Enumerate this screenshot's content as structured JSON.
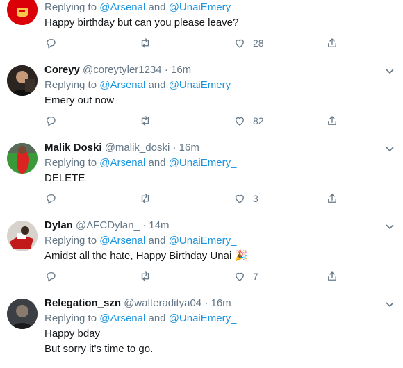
{
  "tweets": [
    {
      "name": "",
      "handle": "",
      "time": "",
      "replying_prefix": "Replying to",
      "mention1": "@Arsenal",
      "and": "and",
      "mention2": "@UnaiEmery_",
      "lines": [
        "Happy birthday but can you please leave?"
      ],
      "likes": "28",
      "avatar": {
        "icon": "arsenal-crest-avatar",
        "bg": "#db0007"
      }
    },
    {
      "name": "Coreyy",
      "handle": "@coreytyler1234",
      "time": "16m",
      "replying_prefix": "Replying to",
      "mention1": "@Arsenal",
      "and": "and",
      "mention2": "@UnaiEmery_",
      "lines": [
        "Emery out now"
      ],
      "likes": "82",
      "avatar": {
        "icon": "user-photo-avatar",
        "bg": "#2b2420"
      }
    },
    {
      "name": "Malik Doski",
      "handle": "@malik_doski",
      "time": "16m",
      "replying_prefix": "Replying to",
      "mention1": "@Arsenal",
      "and": "and",
      "mention2": "@UnaiEmery_",
      "lines": [
        "DELETE"
      ],
      "likes": "3",
      "avatar": {
        "icon": "football-pitch-avatar",
        "bg": "#3a9a3a"
      }
    },
    {
      "name": "Dylan",
      "handle": "@AFCDylan_",
      "time": "14m",
      "replying_prefix": "Replying to",
      "mention1": "@Arsenal",
      "and": "and",
      "mention2": "@UnaiEmery_",
      "lines": [
        "Amidst all the hate, Happy Birthday Unai"
      ],
      "emoji": "🎉",
      "likes": "7",
      "avatar": {
        "icon": "player-photo-avatar",
        "bg": "#d8d2cc"
      }
    },
    {
      "name": "Relegation_szn",
      "handle": "@walteraditya04",
      "time": "16m",
      "replying_prefix": "Replying to",
      "mention1": "@Arsenal",
      "and": "and",
      "mention2": "@UnaiEmery_",
      "lines": [
        "Happy bday",
        "But sorry it's time to go."
      ],
      "likes": "",
      "avatar": {
        "icon": "portrait-photo-avatar",
        "bg": "#3c3f44"
      }
    }
  ],
  "colors": {
    "link": "#1b95e0",
    "muted": "#657786",
    "divider": "#e6ecf0"
  },
  "icons": {
    "reply": "reply-icon",
    "retweet": "retweet-icon",
    "like": "like-icon",
    "share": "share-icon",
    "more": "chevron-down-icon"
  }
}
